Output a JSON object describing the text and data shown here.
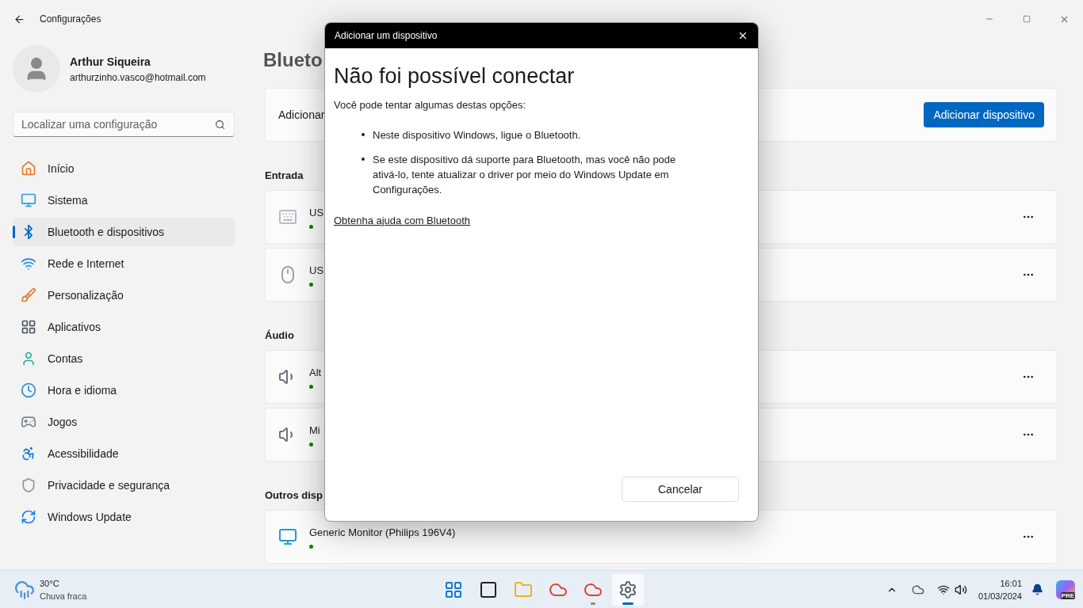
{
  "window": {
    "title": "Configurações"
  },
  "profile": {
    "name": "Arthur Siqueira",
    "email": "arthurzinho.vasco@hotmail.com"
  },
  "search": {
    "placeholder": "Localizar uma configuração"
  },
  "sidebar": {
    "items": [
      {
        "label": "Início",
        "kind": "home",
        "selected": false
      },
      {
        "label": "Sistema",
        "kind": "system",
        "selected": false
      },
      {
        "label": "Bluetooth e dispositivos",
        "kind": "bluetooth",
        "selected": true
      },
      {
        "label": "Rede e Internet",
        "kind": "network",
        "selected": false
      },
      {
        "label": "Personalização",
        "kind": "brush",
        "selected": false
      },
      {
        "label": "Aplicativos",
        "kind": "apps",
        "selected": false
      },
      {
        "label": "Contas",
        "kind": "account",
        "selected": false
      },
      {
        "label": "Hora e idioma",
        "kind": "time",
        "selected": false
      },
      {
        "label": "Jogos",
        "kind": "games",
        "selected": false
      },
      {
        "label": "Acessibilidade",
        "kind": "accessibility",
        "selected": false
      },
      {
        "label": "Privacidade e segurança",
        "kind": "privacy",
        "selected": false
      },
      {
        "label": "Windows Update",
        "kind": "update",
        "selected": false
      }
    ]
  },
  "main": {
    "title": "Blueto",
    "add_card": {
      "label": "Adicionar",
      "button": "Adicionar dispositivo"
    },
    "groups": [
      {
        "title": "Entrada",
        "devices": [
          {
            "name": "US",
            "kind": "keyboard"
          },
          {
            "name": "US",
            "kind": "mouse"
          }
        ]
      },
      {
        "title": "Áudio",
        "devices": [
          {
            "name": "Alt",
            "kind": "speaker"
          },
          {
            "name": "Mi",
            "kind": "speaker"
          }
        ]
      },
      {
        "title": "Outros disp",
        "devices": [
          {
            "name": "Generic Monitor (Philips 196V4)",
            "kind": "monitor"
          }
        ]
      }
    ]
  },
  "dialog": {
    "title": "Adicionar um dispositivo",
    "heading": "Não foi possível conectar",
    "intro": "Você pode tentar algumas destas opções:",
    "bullets": [
      "Neste dispositivo Windows, ligue o Bluetooth.",
      "Se este dispositivo dá suporte para Bluetooth, mas você não pode ativá-lo, tente atualizar o driver por meio do Windows Update em Configurações."
    ],
    "link": "Obtenha ajuda com Bluetooth",
    "button": "Cancelar"
  },
  "taskbar": {
    "weather": {
      "temp": "30°C",
      "condition": "Chuva fraca"
    },
    "apps": [
      {
        "kind": "start",
        "running": false,
        "active": false
      },
      {
        "kind": "taskview",
        "running": false,
        "active": false
      },
      {
        "kind": "explorer",
        "running": false,
        "active": false
      },
      {
        "kind": "chrome",
        "running": false,
        "active": false
      },
      {
        "kind": "chrome",
        "running": true,
        "active": false
      },
      {
        "kind": "settings",
        "running": true,
        "active": true
      }
    ],
    "time": "16:01",
    "date": "01/03/2024",
    "copilot_badge": "PRE"
  }
}
